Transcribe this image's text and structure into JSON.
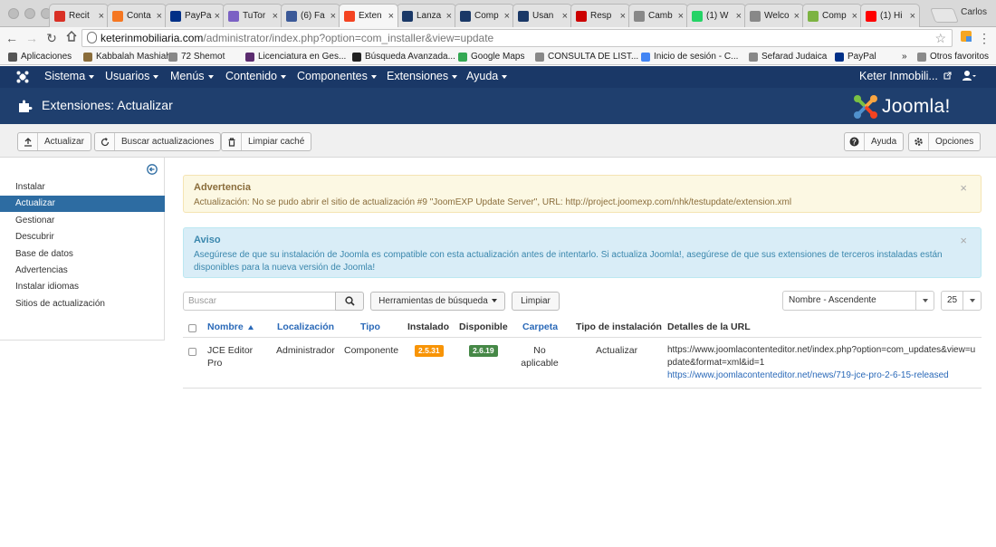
{
  "browser": {
    "tabs": [
      {
        "title": "Recit",
        "icon": "gmail-icon",
        "color": "#d93025"
      },
      {
        "title": "Conta",
        "icon": "hubspot-icon",
        "color": "#f57722"
      },
      {
        "title": "PayPa",
        "icon": "paypal-icon",
        "color": "#003087"
      },
      {
        "title": "TuTor",
        "icon": "tutor-icon",
        "color": "#7b61c4"
      },
      {
        "title": "(6) Fa",
        "icon": "facebook-icon",
        "color": "#3b5998"
      },
      {
        "title": "Exten",
        "icon": "joomla-icon",
        "color": "#f44321",
        "active": true
      },
      {
        "title": "Lanza",
        "icon": "feather-icon",
        "color": "#1a3867"
      },
      {
        "title": "Comp",
        "icon": "feather-icon",
        "color": "#1a3867"
      },
      {
        "title": "Usan",
        "icon": "feather-icon",
        "color": "#1a3867"
      },
      {
        "title": "Resp",
        "icon": "w-icon",
        "color": "#cc0000"
      },
      {
        "title": "Camb",
        "icon": "document-icon",
        "color": "#888888"
      },
      {
        "title": "(1) W",
        "icon": "whatsapp-icon",
        "color": "#25d366"
      },
      {
        "title": "Welco",
        "icon": "document-icon",
        "color": "#888888"
      },
      {
        "title": "Comp",
        "icon": "pin-icon",
        "color": "#7cb342"
      },
      {
        "title": "(1) Hi",
        "icon": "youtube-icon",
        "color": "#ff0000"
      }
    ],
    "profile": "Carlos",
    "url_host": "keterinmobiliaria.com",
    "url_path": "/administrator/index.php?option=com_installer&view=update",
    "bookmarks": [
      {
        "label": "Aplicaciones",
        "icon": "apps-icon",
        "color": "#555555"
      },
      {
        "label": "Kabbalah Mashiah",
        "icon": "star-of-david-icon",
        "color": "#8a6d3b"
      },
      {
        "label": "72 Shemot",
        "icon": "document-icon",
        "color": "#888888"
      },
      {
        "label": "Licenciatura en Ges...",
        "icon": "tree-icon",
        "color": "#5b2c6f"
      },
      {
        "label": "Búsqueda Avanzada...",
        "icon": "x-icon",
        "color": "#222222"
      },
      {
        "label": "Google Maps",
        "icon": "maps-icon",
        "color": "#34a853"
      },
      {
        "label": "CONSULTA DE LIST...",
        "icon": "document-icon",
        "color": "#888888"
      },
      {
        "label": "Inicio de sesión - C...",
        "icon": "google-icon",
        "color": "#4285f4"
      },
      {
        "label": "Sefarad Judaica",
        "icon": "document-icon",
        "color": "#888888"
      },
      {
        "label": "PayPal",
        "icon": "paypal-icon",
        "color": "#003087"
      }
    ],
    "bookmarks_overflow": "»",
    "other_bookmarks": "Otros favoritos"
  },
  "nav": {
    "menus": [
      "Sistema",
      "Usuarios",
      "Menús",
      "Contenido",
      "Componentes",
      "Extensiones",
      "Ayuda"
    ],
    "site_link": "Keter Inmobili..."
  },
  "header": {
    "title": "Extensiones: Actualizar",
    "brand": "Joomla!"
  },
  "toolbar": {
    "update": "Actualizar",
    "find_updates": "Buscar actualizaciones",
    "clear_cache": "Limpiar caché",
    "help": "Ayuda",
    "options": "Opciones"
  },
  "sidebar": {
    "items": [
      {
        "label": "Instalar",
        "active": false
      },
      {
        "label": "Actualizar",
        "active": true
      },
      {
        "label": "Gestionar",
        "active": false
      },
      {
        "label": "Descubrir",
        "active": false
      },
      {
        "label": "Base de datos",
        "active": false
      },
      {
        "label": "Advertencias",
        "active": false
      },
      {
        "label": "Instalar idiomas",
        "active": false
      },
      {
        "label": "Sitios de actualización",
        "active": false
      }
    ]
  },
  "alerts": {
    "warning": {
      "heading": "Advertencia",
      "text": "Actualización: No se pudo abrir el sitio de actualización #9 \"JoomEXP Update Server\", URL: http://project.joomexp.com/nhk/testupdate/extension.xml",
      "close": "×"
    },
    "info": {
      "heading": "Aviso",
      "text": "Asegúrese de que su instalación de Joomla es compatible con esta actualización antes de intentarlo. Si actualiza Joomla!, asegúrese de que sus extensiones de terceros instaladas están disponibles para la nueva versión de Joomla!",
      "close": "×"
    }
  },
  "filters": {
    "search_placeholder": "Buscar",
    "search_tools": "Herramientas de búsqueda",
    "clear": "Limpiar",
    "sort": "Nombre - Ascendente",
    "limit": "25"
  },
  "table": {
    "columns": {
      "name": "Nombre",
      "location": "Localización",
      "type": "Tipo",
      "installed": "Instalado",
      "available": "Disponible",
      "folder": "Carpeta",
      "install_type": "Tipo de instalación",
      "url_details": "Detalles de la URL"
    },
    "rows": [
      {
        "name": "JCE Editor Pro",
        "location": "Administrador",
        "type": "Componente",
        "installed": "2.5.31",
        "available": "2.6.19",
        "folder": "No aplicable",
        "install_type": "Actualizar",
        "url_details": "https://www.joomlacontenteditor.net/index.php?option=com_updates&view=update&format=xml&id=1",
        "info_url": "https://www.joomlacontenteditor.net/news/719-jce-pro-2-6-15-released"
      }
    ]
  },
  "colors": {
    "nav_bg": "#1a3867",
    "subhead_bg": "#1f3f6e",
    "sidebar_active": "#2d6ca2",
    "badge_installed": "#f89406",
    "badge_available": "#468847",
    "link": "#2a69b8"
  }
}
